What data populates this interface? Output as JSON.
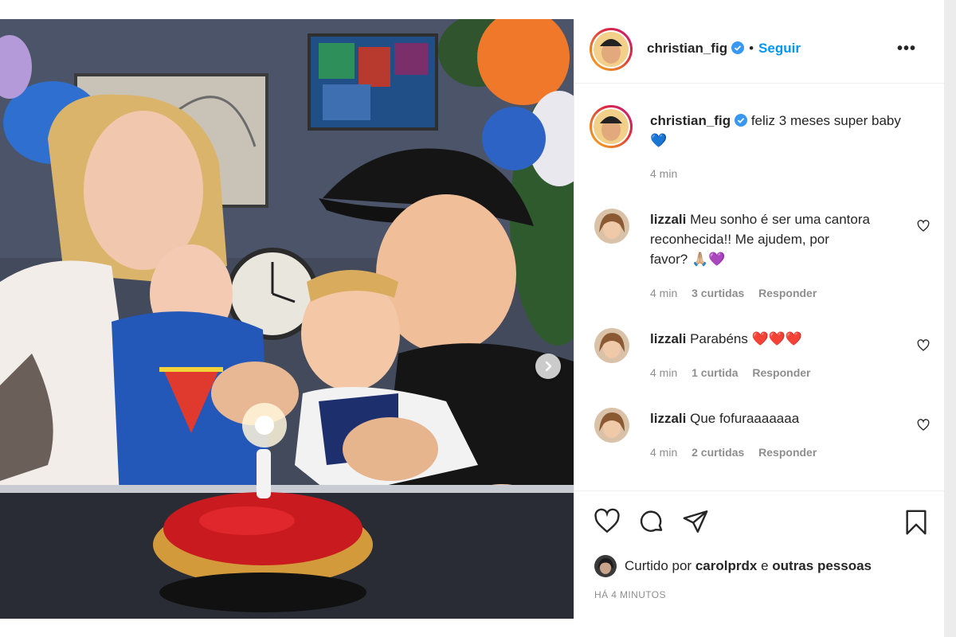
{
  "post": {
    "author": {
      "username": "christian_fig",
      "verified": true,
      "separator": "•",
      "follow_label": "Seguir"
    },
    "more_label": "•••",
    "caption": {
      "username": "christian_fig",
      "text": "feliz 3 meses super baby",
      "emoji": "💙",
      "time": "4 min"
    },
    "comments": [
      {
        "username": "lizzali",
        "line1": "Meu sonho é ser uma cantora",
        "line2": "reconhecida!! Me ajudem, por",
        "line3": "favor? 🙏🏼💜",
        "time": "4 min",
        "likes": "3 curtidas",
        "reply": "Responder"
      },
      {
        "username": "lizzali",
        "text": "Parabéns ❤️❤️❤️",
        "time": "4 min",
        "likes": "1 curtida",
        "reply": "Responder"
      },
      {
        "username": "lizzali",
        "text": "Que fofuraaaaaaa",
        "time": "4 min",
        "likes": "2 curtidas",
        "reply": "Responder"
      }
    ],
    "liked_by": {
      "prefix": "Curtido por",
      "user": "carolprdx",
      "conjunction": "e",
      "others": "outras pessoas"
    },
    "timestamp": "HÁ 4 MINUTOS",
    "icons": [
      "heart-icon",
      "comment-icon",
      "share-icon",
      "bookmark-icon",
      "chevron-right-icon",
      "verified-icon",
      "more-icon"
    ],
    "colors": {
      "link_blue": "#0095f6",
      "text": "#262626",
      "muted": "#8e8e8e",
      "border": "#efefef"
    }
  }
}
